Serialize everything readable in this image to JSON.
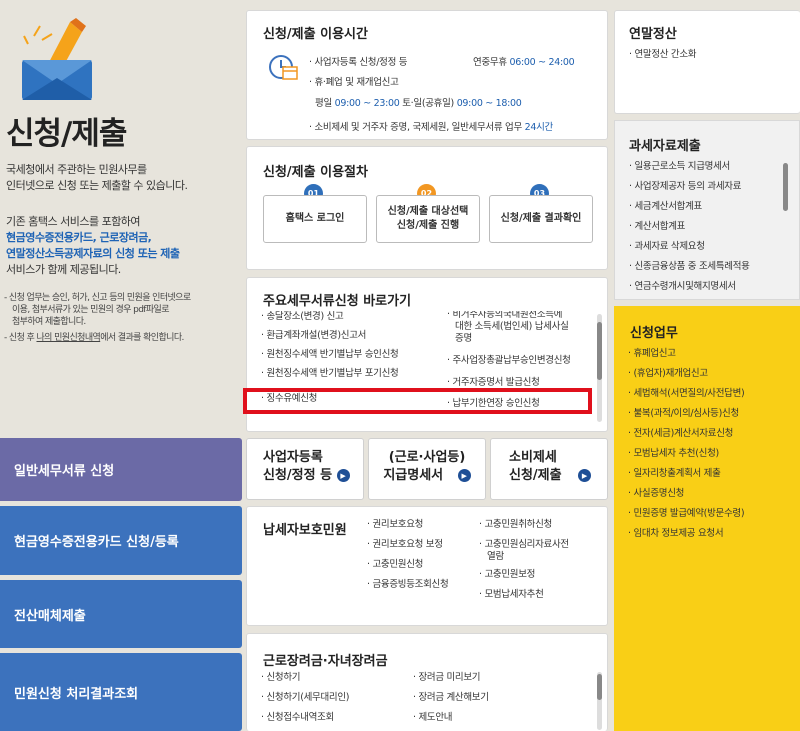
{
  "left": {
    "title": "신청/제출",
    "desc1": "국세청에서 주관하는 민원사무를",
    "desc2": "인터넷으로 신청 또는 제출할 수 있습니다.",
    "desc3": "기존 홈택스 서비스를 포함하여",
    "desc4": "현금영수증전용카드, 근로장려금,",
    "desc5a": "연말정산소득공제자료의 신청 또는 제출",
    "desc6": "서비스가 함께 제공됩니다.",
    "note1a": "- 신청 업무는 승인, 허가, 신고 등의 민원을 인터넷으로",
    "note1b": "이용, 첨부서류가 있는 민원의 경우 pdf파일로",
    "note1c": "첨부하여 제출합니다.",
    "note2a": "- 신청 후 ",
    "note2b": "나의 민원신청내역",
    "note2c": "에서 결과를 확인합니다.",
    "buttons": [
      "일반세무서류 신청",
      "현금영수증전용카드 신청/등록",
      "전산매체제출",
      "민원신청 처리결과조회"
    ]
  },
  "hours": {
    "title": "신청/제출 이용시간",
    "r1_label": "· 사업자등록 신청/정정 등",
    "r1_day": "연중무휴",
    "r1_time": "06:00 ~ 24:00",
    "r2_label": "· 휴·폐업 및 재개업신고",
    "r3_a": "평일",
    "r3_b": "09:00 ~ 23:00",
    "r3_c": "토·일(공휴일)",
    "r3_d": "09:00 ~ 18:00",
    "r4_label": "· 소비제세 및 거주자 증명, 국제세원, 일반세무서류 업무",
    "r4_time": "24시간"
  },
  "procedure": {
    "title": "신청/제출 이용절차",
    "steps": [
      {
        "num": "01",
        "line1": "홈택스 로그인",
        "line2": ""
      },
      {
        "num": "02",
        "line1": "신청/제출 대상선택",
        "line2": "신청/제출 진행"
      },
      {
        "num": "03",
        "line1": "신청/제출 결과확인",
        "line2": ""
      }
    ]
  },
  "shortcuts": {
    "title": "주요세무서류신청 바로가기",
    "col1": [
      "· 송달장소(변경) 신고",
      "· 환급계좌개설(변경)신고서",
      "· 원천징수세액 반기별납부 승인신청",
      "· 원천징수세액 반기별납부 포기신청",
      "· 징수유예신청"
    ],
    "col2a": "· 비거주자등의국내원천소득에",
    "col2b": "대한 소득세(법인세) 납세사실",
    "col2c": "증명",
    "col2d": "· 주사업장총괄납부승인변경신청",
    "col2e": "· 거주자증명서 발급신청",
    "col2f": "· 납부기한연장 승인신청"
  },
  "quick": [
    {
      "l1": "사업자등록",
      "l2": "신청/정정 등"
    },
    {
      "l1": "(근로·사업등)",
      "l2": "지급명세서"
    },
    {
      "l1": "소비제세",
      "l2": "신청/제출"
    }
  ],
  "protect": {
    "title": "납세자보호민원",
    "c1": [
      "· 권리보호요청",
      "· 권리보호요청 보정",
      "· 고충민원신청",
      "· 금융증빙등조회신청"
    ],
    "c2a": "· 고충민원취하신청",
    "c2b": "· 고충민원심리자료사전",
    "c2c": "열람",
    "c2d": "· 고충민원보정",
    "c2e": "· 모범납세자추천"
  },
  "encourage": {
    "title": "근로장려금·자녀장려금",
    "c1": [
      "· 신청하기",
      "· 신청하기(세무대리인)",
      "· 신청접수내역조회"
    ],
    "c2": [
      "· 장려금 미리보기",
      "· 장려금 계산해보기",
      "· 제도안내"
    ]
  },
  "yearend": {
    "title": "연말정산",
    "items": [
      "· 연말정산 간소화"
    ]
  },
  "taxdata": {
    "title": "과세자료제출",
    "items": [
      "· 일용근로소득 지급명세서",
      "· 사업장제공자 등의 과세자료",
      "· 세금계산서합계표",
      "· 계산서합계표",
      "· 과세자료 삭제요청",
      "· 신종금융상품 중 조세특례적용",
      "· 연금수령개시및해지명세서"
    ]
  },
  "apply": {
    "title": "신청업무",
    "items": [
      "· 휴폐업신고",
      "· (휴업자)재개업신고",
      "· 세법해석(서면질의/사전답변)",
      "· 불복(과적/이의/심사등)신청",
      "· 전자(세금)계산서자료신청",
      "· 모범납세자 추천(신청)",
      "· 일자리창출계획서 제출",
      "· 사실증명신청",
      "· 민원증명 발급예약(방문수령)",
      "· 임대차 정보제공 요청서"
    ]
  },
  "colors": {
    "side_purple": "#6b6aa6",
    "side_blue": "#3c72bd",
    "accent_blue": "#1e5fae",
    "yellow": "#f9cf16",
    "red_box": "#e0101c",
    "orange": "#f29722"
  }
}
